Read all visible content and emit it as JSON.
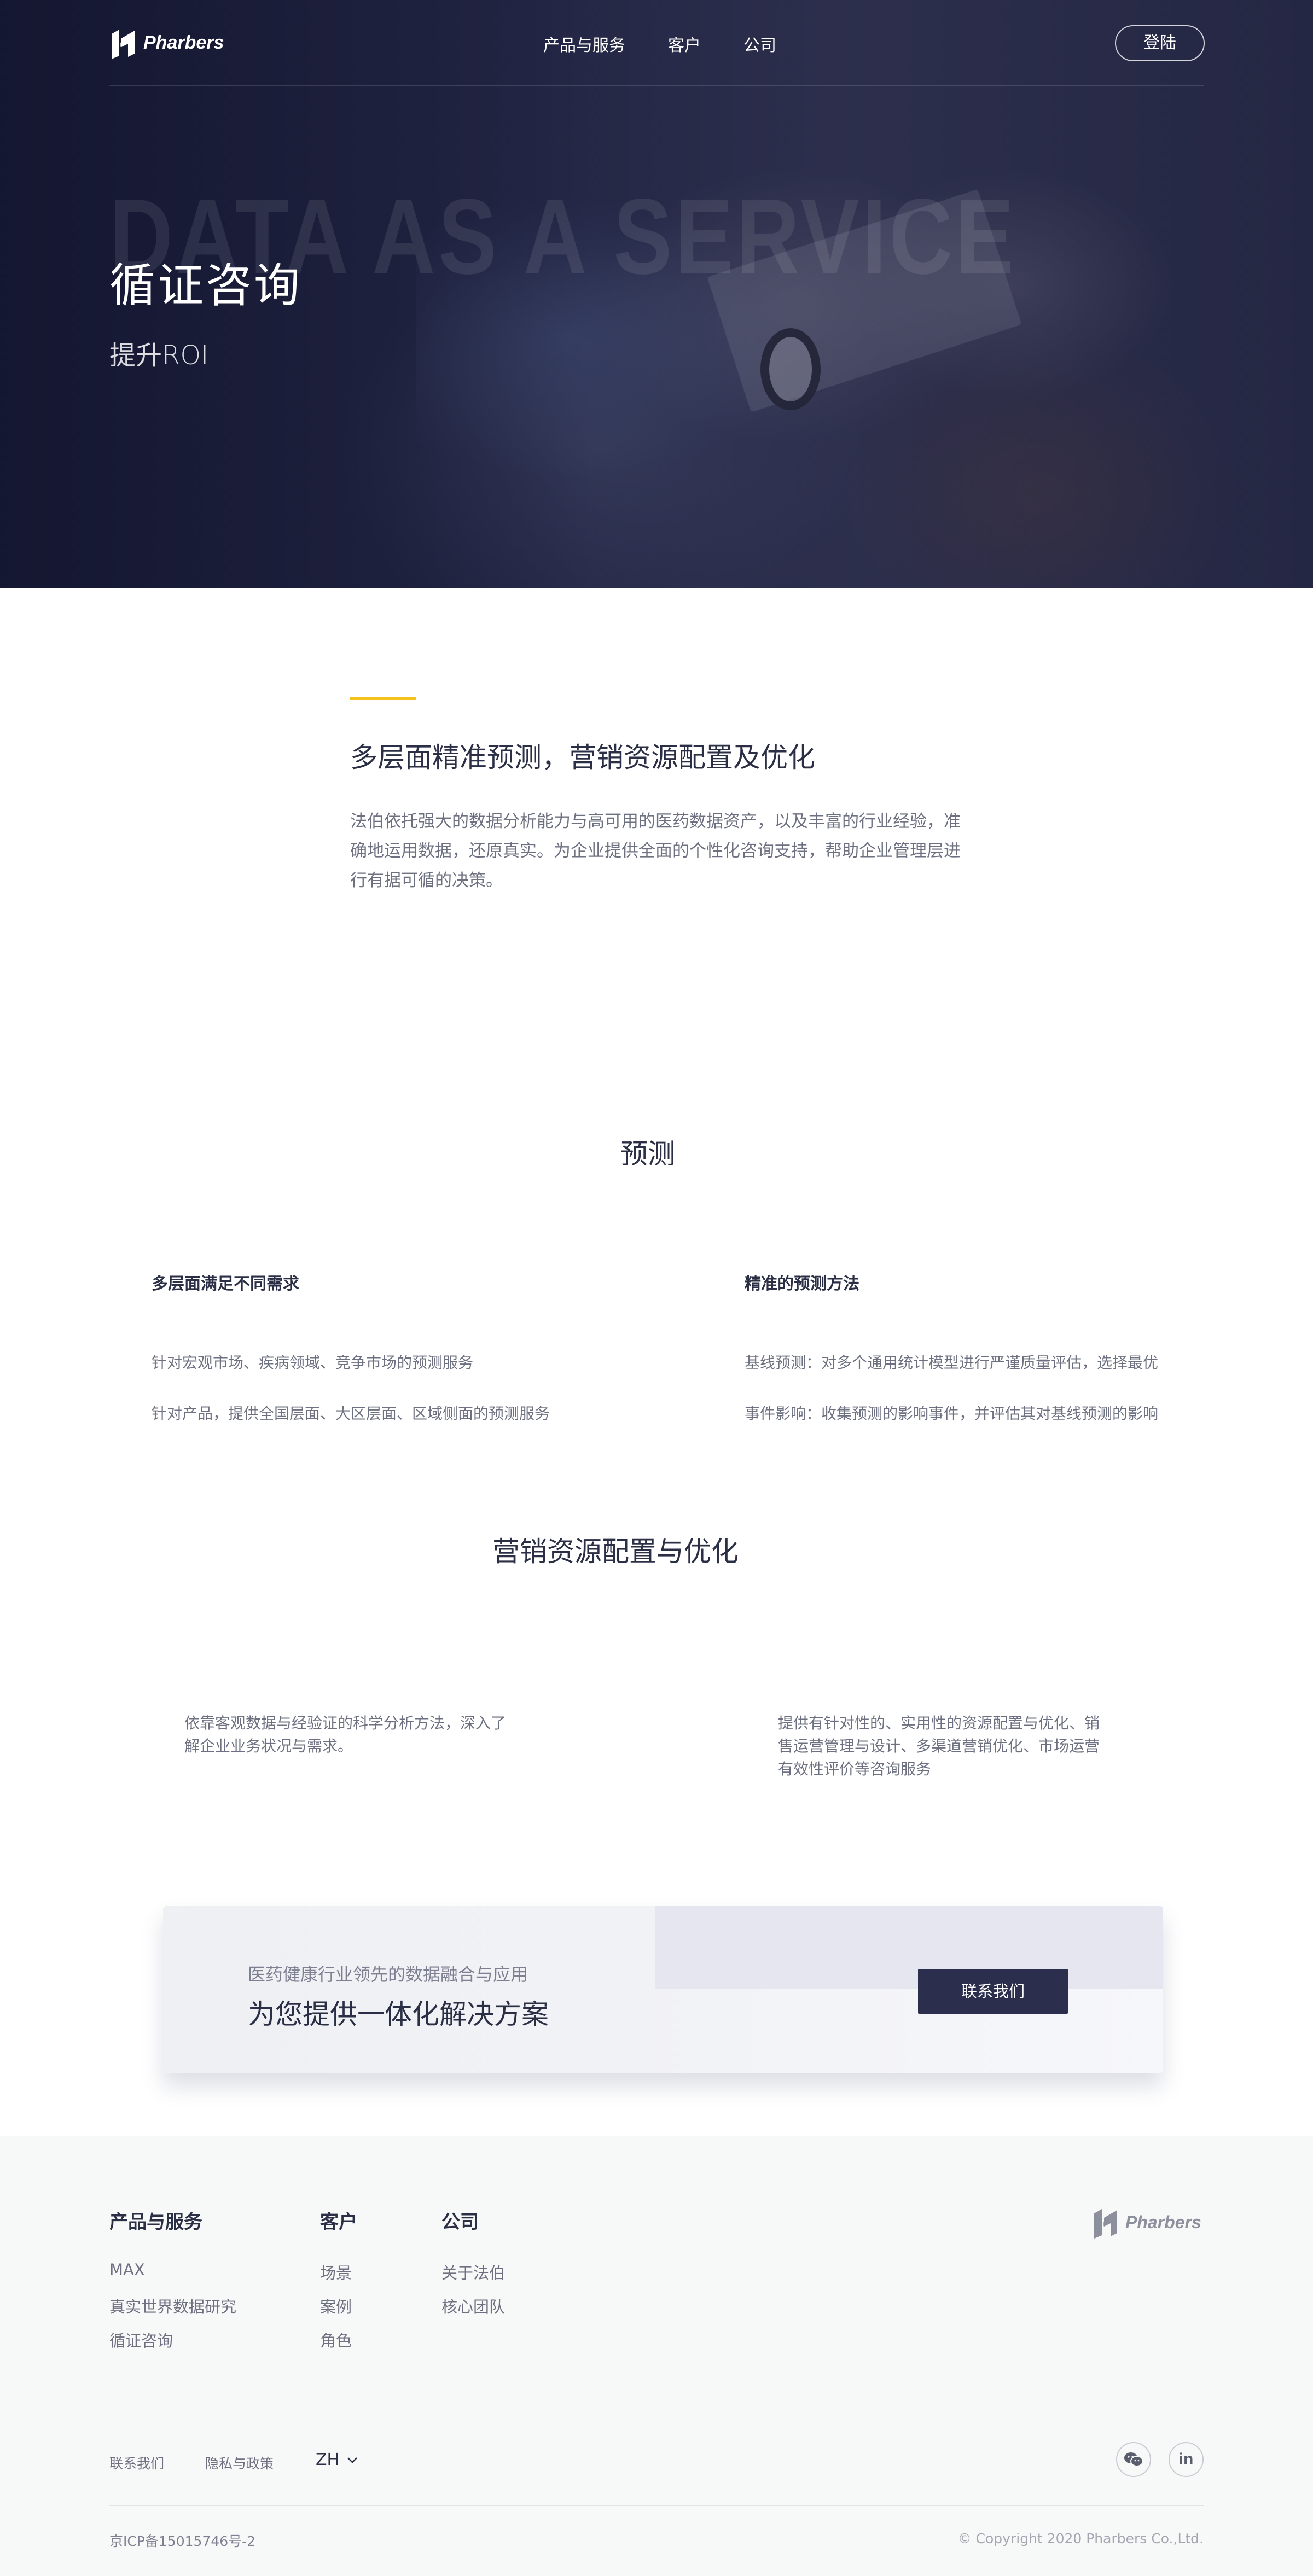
{
  "brand": {
    "name": "Pharbers"
  },
  "nav": {
    "links": [
      "产品与服务",
      "客户",
      "公司"
    ],
    "login": "登陆"
  },
  "hero": {
    "watermark": "DATA AS A SERVICE",
    "title": "循证咨询",
    "subtitle": "提升ROI"
  },
  "intro": {
    "title": "多层面精准预测，营销资源配置及优化",
    "body": "法伯依托强大的数据分析能力与高可用的医药数据资产，以及丰富的行业经验，准确地运用数据，还原真实。为企业提供全面的个性化咨询支持，帮助企业管理层进行有据可循的决策。"
  },
  "forecast": {
    "title": "预测",
    "left": {
      "title": "多层面满足不同需求",
      "items": [
        "针对宏观市场、疾病领域、竞争市场的预测服务",
        "针对产品，提供全国层面、大区层面、区域侧面的预测服务"
      ]
    },
    "right": {
      "title": "精准的预测方法",
      "items": [
        "基线预测：对多个通用统计模型进行严谨质量评估，选择最优",
        "事件影响：收集预测的影响事件，并评估其对基线预测的影响"
      ]
    }
  },
  "marketing": {
    "title": "营销资源配置与优化",
    "left": "依靠客观数据与经验证的科学分析方法，深入了解企业业务状况与需求。",
    "right": "提供有针对性的、实用性的资源配置与优化、销售运营管理与设计、多渠道营销优化、市场运营有效性评价等咨询服务"
  },
  "cta": {
    "small": "医药健康行业领先的数据融合与应用",
    "big": "为您提供一体化解决方案",
    "button": "联系我们"
  },
  "footer": {
    "columns": [
      {
        "title": "产品与服务",
        "items": [
          "MAX",
          "真实世界数据研究",
          "循证咨询"
        ]
      },
      {
        "title": "客户",
        "items": [
          "场景",
          "案例",
          "角色"
        ]
      },
      {
        "title": "公司",
        "items": [
          "关于法伯",
          "核心团队"
        ]
      }
    ],
    "bottom_links": [
      "联系我们",
      "隐私与政策"
    ],
    "language": "ZH",
    "icp": "京ICP备15015746号-2",
    "copyright": "© Copyright 2020 Pharbers Co.,Ltd."
  },
  "colors": {
    "accent": "#f4c21b",
    "primary": "#2b2f4d"
  }
}
